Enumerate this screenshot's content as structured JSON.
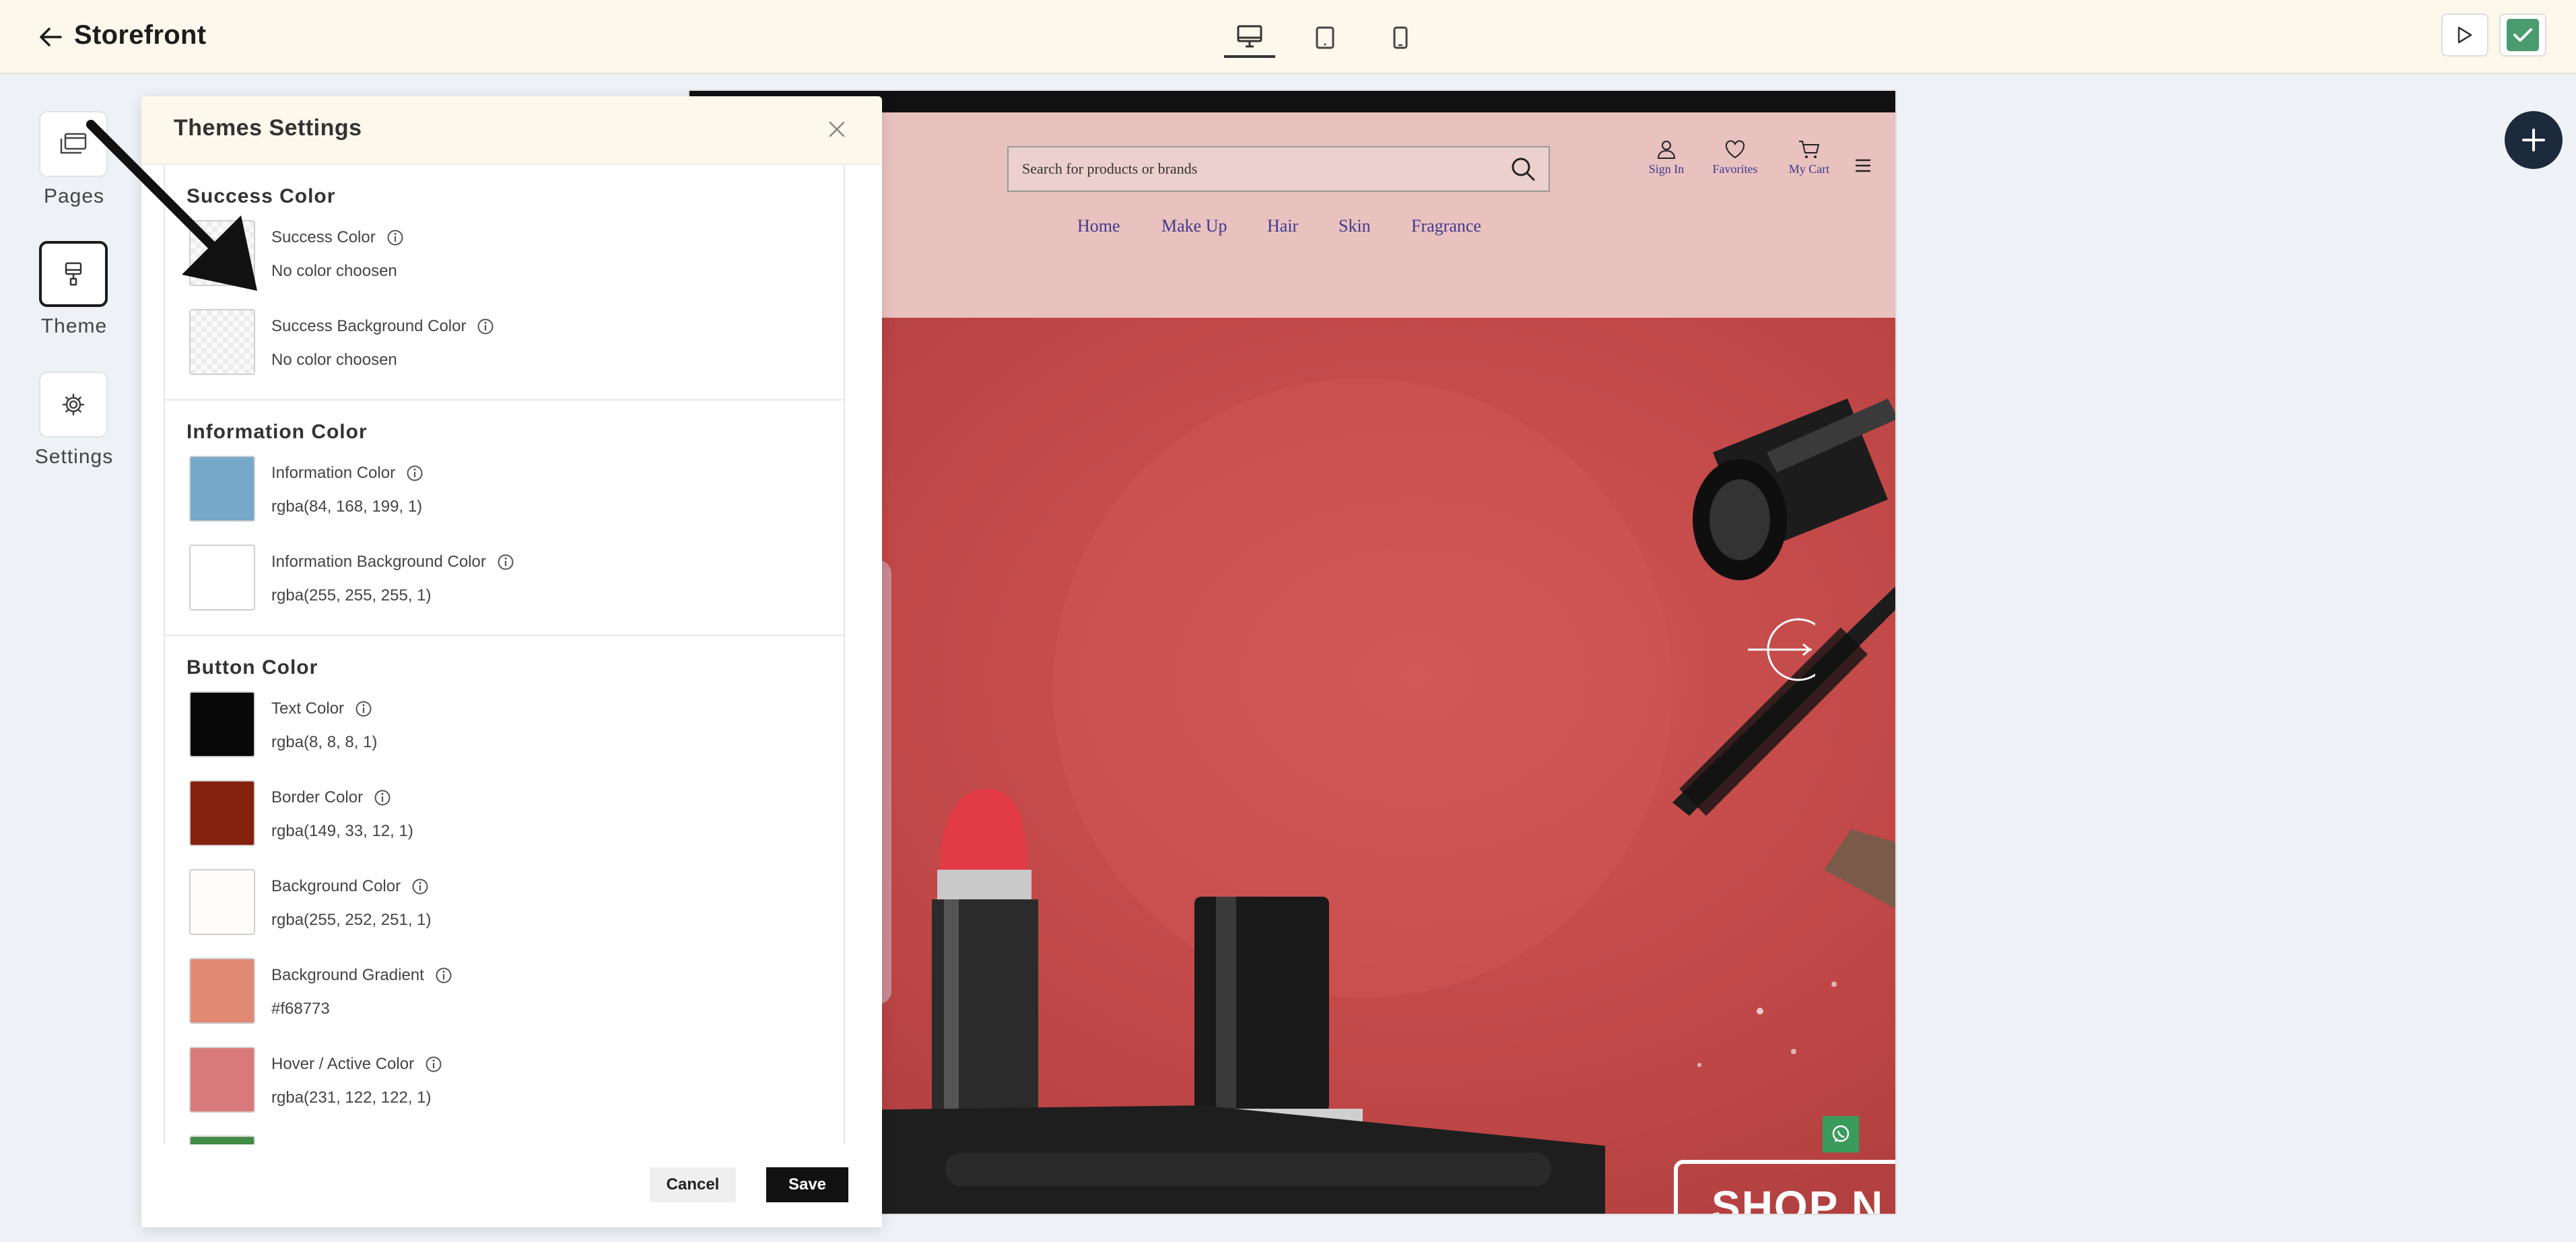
{
  "app": {
    "title": "Storefront"
  },
  "toolbar": {
    "devices": [
      "desktop-icon",
      "tablet-icon",
      "mobile-icon"
    ],
    "active_device": "desktop",
    "accent_color": "#4a9b6e"
  },
  "sidebar": {
    "items": [
      {
        "label": "Pages",
        "icon": "pages-icon"
      },
      {
        "label": "Theme",
        "icon": "brush-icon",
        "active": true
      },
      {
        "label": "Settings",
        "icon": "gear-icon"
      }
    ]
  },
  "panel": {
    "title": "Themes Settings",
    "cancel_label": "Cancel",
    "save_label": "Save",
    "sections": [
      {
        "title": "Success Color",
        "rows": [
          {
            "label": "Success Color",
            "value": "No color choosen",
            "color": ""
          },
          {
            "label": "Success Background Color",
            "value": "No color choosen",
            "color": ""
          }
        ]
      },
      {
        "title": "Information Color",
        "rows": [
          {
            "label": "Information Color",
            "value": "rgba(84, 168, 199, 1)",
            "color": "#76a8c8"
          },
          {
            "label": "Information Background Color",
            "value": "rgba(255, 255, 255, 1)",
            "color": "#ffffff"
          }
        ]
      },
      {
        "title": "Button Color",
        "rows": [
          {
            "label": "Text Color",
            "value": "rgba(8, 8, 8, 1)",
            "color": "#080808"
          },
          {
            "label": "Border Color",
            "value": "rgba(149, 33, 12, 1)",
            "color": "#85210f"
          },
          {
            "label": "Background Color",
            "value": "rgba(255, 252, 251, 1)",
            "color": "#fffcfb"
          },
          {
            "label": "Background Gradient",
            "value": "#f68773",
            "color": "#e08a74"
          },
          {
            "label": "Hover / Active Color",
            "value": "rgba(231, 122, 122, 1)",
            "color": "#d87a7c"
          }
        ]
      }
    ]
  },
  "preview": {
    "search_placeholder": "Search for products or brands",
    "actions": [
      {
        "label": "Sign In",
        "icon": "user-icon"
      },
      {
        "label": "Favorites",
        "icon": "heart-icon"
      },
      {
        "label": "My Cart",
        "icon": "cart-icon"
      }
    ],
    "nav": [
      "Home",
      "Make Up",
      "Hair",
      "Skin",
      "Fragrance"
    ],
    "banner_cta": "SHOP N",
    "header_bg": "#e9c1bf",
    "hero_bg": "#c94848"
  }
}
